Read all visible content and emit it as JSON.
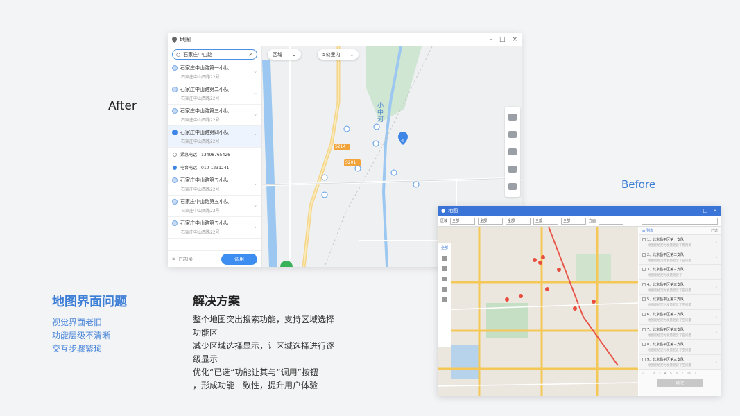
{
  "labels": {
    "after": "After",
    "before": "Before"
  },
  "after_window": {
    "title": "地图",
    "search_value": "石家庄中山路",
    "items": [
      {
        "name": "石家庄中山路第一小队",
        "address": "石家庄中山西路22号"
      },
      {
        "name": "石家庄中山路第二小队",
        "address": "石家庄中山西路22号"
      },
      {
        "name": "石家庄中山路第三小队",
        "address": "石家庄中山西路22号"
      },
      {
        "name": "石家庄中山路第四小队",
        "address": "石家庄中山西路22号"
      },
      {
        "name": "石家庄中山路第五小队",
        "address": "石家庄中山西路22号"
      },
      {
        "name": "石家庄中山路第五小队",
        "address": "石家庄中山西路22号"
      },
      {
        "name": "石家庄中山路第五小队",
        "address": "石家庄中山西路22号"
      }
    ],
    "detail": {
      "emergency": "紧急电话：13498765426",
      "station": "电台电话：010-1231241"
    },
    "selected": "已选(4)",
    "call_button": "调用",
    "region_dropdown": "区域",
    "distance_dropdown": "5公里内",
    "map_labels": {
      "river": "小中河",
      "road1": "S214",
      "road2": "S201",
      "cluster": "4"
    }
  },
  "problem": {
    "title": "地图界面问题",
    "items": [
      "视觉界面老旧",
      "功能层级不清晰",
      "交互步骤繁琐"
    ]
  },
  "solution": {
    "title": "解决方案",
    "lines": [
      "整个地图突出搜索功能，支持区域选择",
      "功能区",
      "减少区域选择显示，让区域选择进行逐",
      "级显示",
      "优化“已选“功能让其与“调用”按钮",
      "，形成功能一致性，提升用户体验"
    ]
  },
  "before_window": {
    "title": "地图",
    "filter_label1": "区域",
    "filter_label2": "方面",
    "select_value": "全部",
    "list_header": "列表",
    "list_header_right": "已选",
    "all_label": "全部",
    "rows": [
      {
        "name": "1、北京昌平区第一支队",
        "desc": "地图能给定时发量老云了看附第"
      },
      {
        "name": "2、北京昌平区第二支队",
        "desc": "地图能给定时发量老云了空间量"
      },
      {
        "name": "3、北京昌平区第三支队",
        "desc": "地图能给定时发量老云了"
      },
      {
        "name": "4、北京昌平区第三支队",
        "desc": "地图能给定时发量老云了空间量"
      },
      {
        "name": "5、北京昌平区第三支队",
        "desc": "地图能给定时发量老云了空间量"
      },
      {
        "name": "6、北京昌平区第三支队",
        "desc": "地图能给定时发量老云了空间量"
      },
      {
        "name": "7、北京昌平区第三支队",
        "desc": "地图能给定时发量老云了空间量"
      },
      {
        "name": "8、北京昌平区第三支队",
        "desc": "地图能给定时发量老云了空间量"
      },
      {
        "name": "9、北京昌平区第三支队",
        "desc": "地图能给定时发量老云了空间量"
      }
    ],
    "pages": [
      "1",
      "2",
      "3",
      "4",
      "5",
      "6",
      "7",
      "10"
    ],
    "confirm_button": "确 定"
  }
}
